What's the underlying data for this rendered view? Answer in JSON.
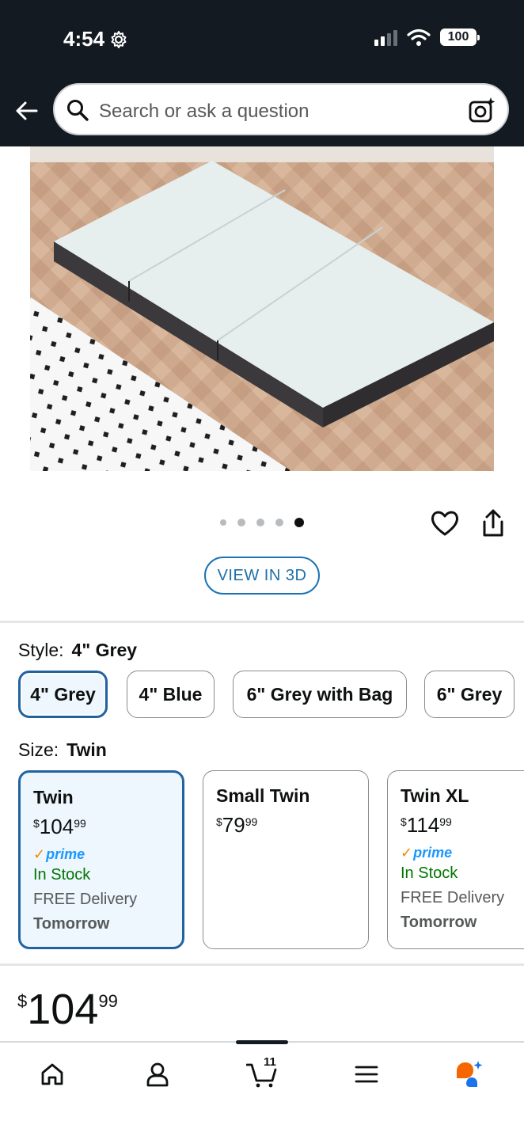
{
  "status_bar": {
    "time": "4:54",
    "battery": "100"
  },
  "header": {
    "search_placeholder": "Search or ask a question"
  },
  "carousel": {
    "image_count": 5,
    "active_index": 4,
    "view3d_label": "VIEW IN 3D"
  },
  "style": {
    "label": "Style:",
    "selected": "4\" Grey",
    "options": [
      "4\" Grey",
      "4\" Blue",
      "6\" Grey with Bag",
      "6\" Grey"
    ]
  },
  "size": {
    "label": "Size:",
    "selected": "Twin",
    "options": [
      {
        "name": "Twin",
        "currency": "$",
        "whole": "104",
        "fraction": "99",
        "prime": "prime",
        "stock": "In Stock",
        "delivery": "FREE Delivery",
        "delivery_day": "Tomorrow"
      },
      {
        "name": "Small Twin",
        "currency": "$",
        "whole": "79",
        "fraction": "99"
      },
      {
        "name": "Twin XL",
        "currency": "$",
        "whole": "114",
        "fraction": "99",
        "prime": "prime",
        "stock": "In Stock",
        "delivery": "FREE Delivery",
        "delivery_day": "Tomorrow"
      }
    ]
  },
  "price": {
    "currency": "$",
    "whole": "104",
    "fraction": "99"
  },
  "bottom_nav": {
    "items": [
      "home-icon",
      "account-icon",
      "cart-icon",
      "menu-icon",
      "rufus-icon"
    ],
    "cart_count": "11"
  },
  "colors": {
    "header_bg": "#131a22",
    "accent_blue": "#2162a1",
    "selected_bg": "#edf7fd",
    "in_stock": "#007600",
    "prime_blue": "#1a98ff",
    "prime_check": "#f08804"
  }
}
